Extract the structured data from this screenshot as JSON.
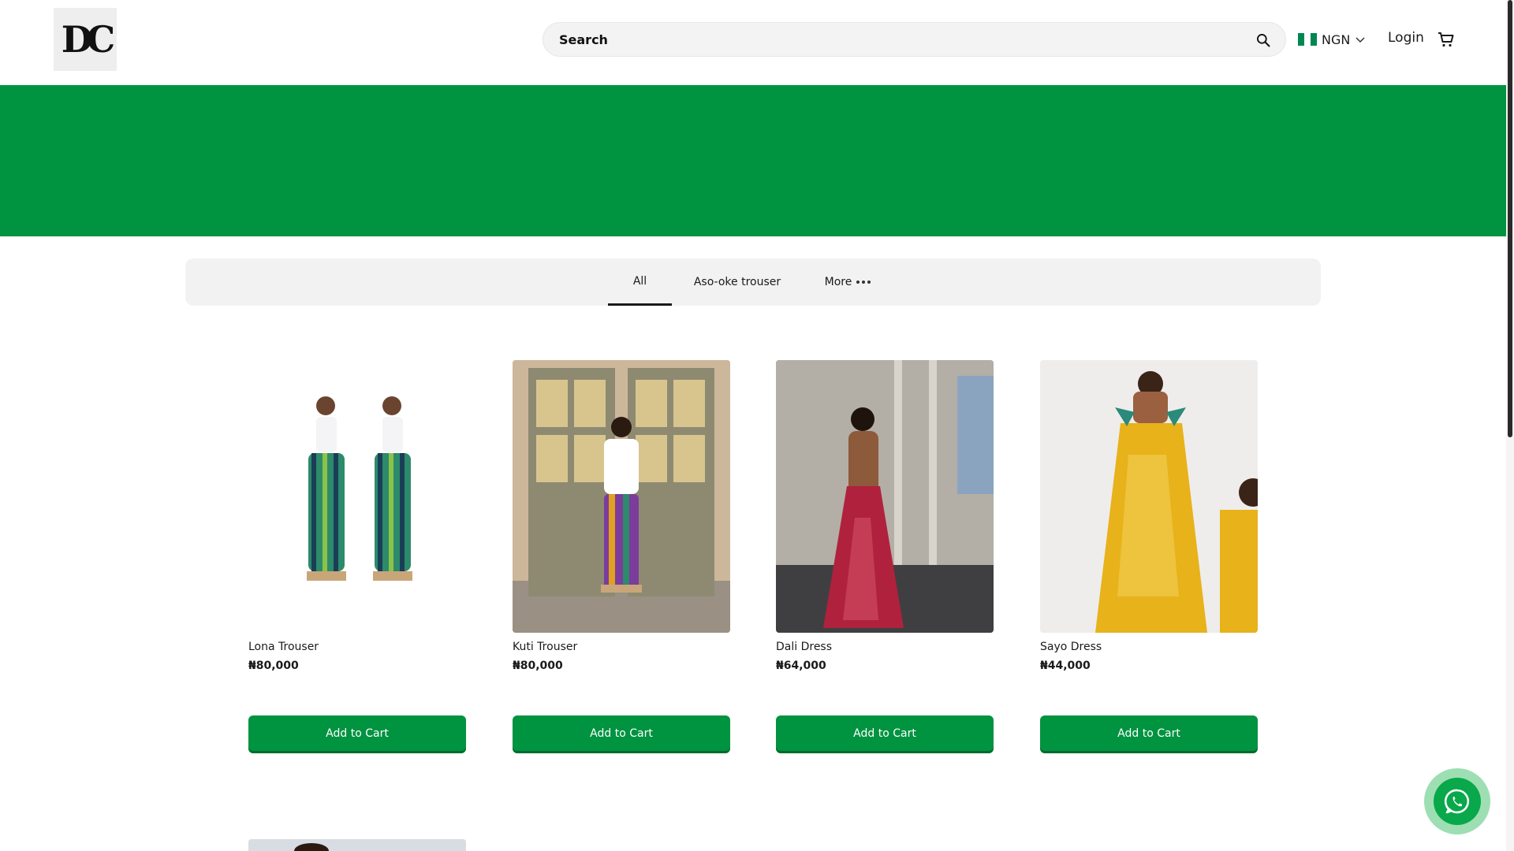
{
  "brand": {
    "logo_text": "DC"
  },
  "header": {
    "search_placeholder": "Search",
    "currency": "NGN",
    "login_label": "Login"
  },
  "colors": {
    "brand_green": "#009340",
    "flag_green": "#008751",
    "flag_white": "#ffffff",
    "whatsapp_green": "#09a84a"
  },
  "categories": {
    "tabs": [
      {
        "label": "All",
        "active": true
      },
      {
        "label": "Aso-oke trouser",
        "active": false
      },
      {
        "label": "More",
        "active": false
      }
    ]
  },
  "products": [
    {
      "name": "Lona Trouser",
      "price": "₦80,000",
      "button": "Add to Cart"
    },
    {
      "name": "Kuti Trouser",
      "price": "₦80,000",
      "button": "Add to Cart"
    },
    {
      "name": "Dali Dress",
      "price": "₦64,000",
      "button": "Add to Cart"
    },
    {
      "name": "Sayo Dress",
      "price": "₦44,000",
      "button": "Add to Cart"
    }
  ],
  "icons": {
    "search": "search-icon",
    "cart": "cart-icon",
    "chevron": "chevron-down-icon",
    "more": "more-dots-icon",
    "whatsapp": "whatsapp-icon"
  }
}
